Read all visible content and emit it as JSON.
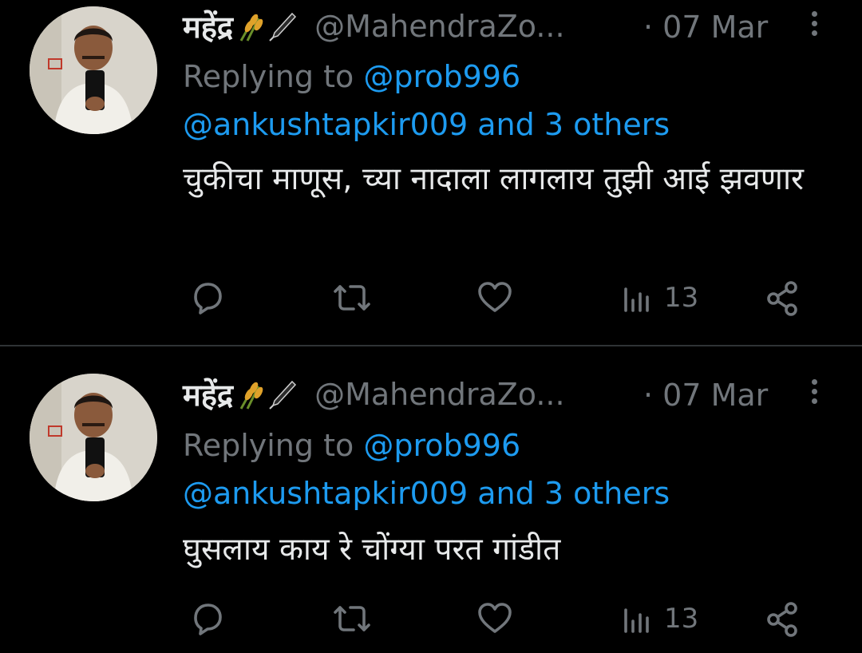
{
  "tweets": [
    {
      "author_name": "महेंद्र",
      "author_emoji": [
        "sheaf-of-rice-icon",
        "fountain-pen-icon"
      ],
      "handle": "@MahendraZo...",
      "date": "· 07 Mar",
      "replying_label": "Replying to",
      "reply_to_first": "@prob996",
      "reply_to_rest": "@ankushtapkir009 and 3 others",
      "text": "चुकीचा माणूस, च्या नादाला लागलाय तुझी आई झवणार",
      "views": "13"
    },
    {
      "author_name": "महेंद्र",
      "author_emoji": [
        "sheaf-of-rice-icon",
        "fountain-pen-icon"
      ],
      "handle": "@MahendraZo...",
      "date": "· 07 Mar",
      "replying_label": "Replying to",
      "reply_to_first": "@prob996",
      "reply_to_rest": "@ankushtapkir009 and 3 others",
      "text": "घुसलाय काय रे चोंग्या परत गांडीत",
      "views": "13"
    }
  ],
  "colors": {
    "background": "#000000",
    "text": "#e7e9ea",
    "muted": "#71767b",
    "link": "#1d9bf0",
    "divider": "#2f3336"
  }
}
